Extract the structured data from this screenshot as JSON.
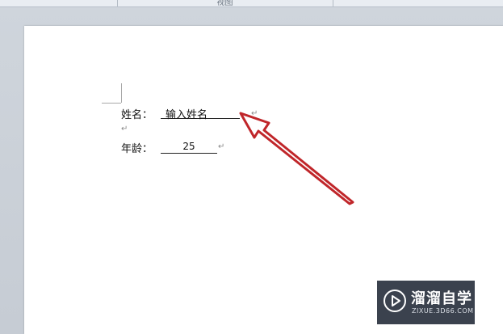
{
  "ribbon": {
    "group_label": "视图"
  },
  "document": {
    "name_label": "姓名：",
    "name_value": "输入姓名",
    "age_label": "年龄：",
    "age_value": "25",
    "para_mark": "↵"
  },
  "watermark": {
    "title": "溜溜自学",
    "url": "ZIXUE.3D66.COM",
    "icon": "play-icon"
  },
  "annotation": {
    "arrow_color": "#c0262a"
  }
}
